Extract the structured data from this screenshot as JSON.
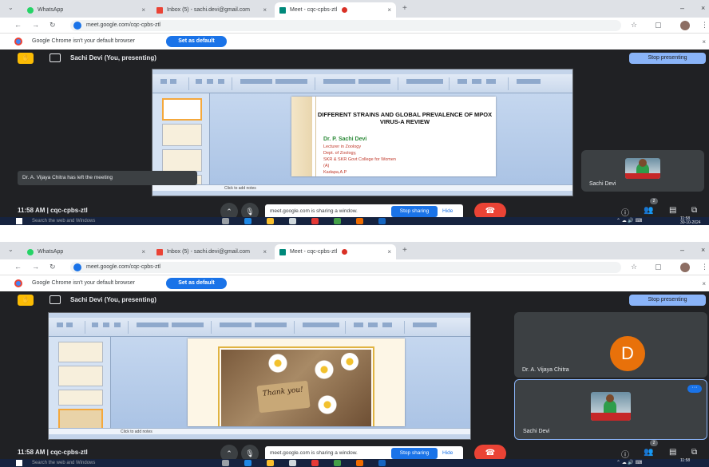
{
  "browser": {
    "tabs": [
      {
        "label": "WhatsApp",
        "color": "#25d366"
      },
      {
        "label": "Inbox (5) - sachi.devi@gmail.com",
        "color": "#ea4335"
      },
      {
        "label": "Meet - cqc-cpbs-ztl",
        "color": "#00897b"
      }
    ],
    "url": "meet.google.com/cqc-cpbs-ztl",
    "default_message": "Google Chrome isn't your default browser",
    "set_default_label": "Set as default"
  },
  "meet": {
    "presenting_label": "Sachi Devi (You, presenting)",
    "stop_presenting_label": "Stop presenting",
    "clock_text": "11:58 AM  |  cqc-cpbs-ztl",
    "share_bar_text": "meet.google.com is sharing a window.",
    "stop_sharing_label": "Stop sharing",
    "hide_label": "Hide",
    "toast_text": "Dr. A. Vijaya Chitra has left the meeting",
    "participant_badge": "2",
    "accent_color": "#8ab4f8",
    "hangup_color": "#ea4335"
  },
  "screen1": {
    "slide": {
      "title": "DIFFERENT STRAINS AND GLOBAL PREVALENCE OF MPOX VIRUS-A REVIEW",
      "author": "Dr. P. Sachi Devi",
      "lines": [
        "Lecturer in Zoology",
        "Dept. of Zoology,",
        "SKR & SKR Govt College for Women",
        "(A)",
        "Kadapa,A.P"
      ]
    },
    "notes_placeholder": "Click to add notes",
    "participants": [
      {
        "name": "Sachi Devi"
      }
    ]
  },
  "screen2": {
    "slide": {
      "thank_you": "Thank you!"
    },
    "notes_placeholder": "Click to add notes",
    "participants": [
      {
        "name": "Dr. A. Vijaya Chitra",
        "initial": "D"
      },
      {
        "name": "Sachi Devi"
      }
    ]
  },
  "taskbar": {
    "search_placeholder": "Search the web and Windows",
    "time": "11:58",
    "date": "30-10-2024"
  }
}
